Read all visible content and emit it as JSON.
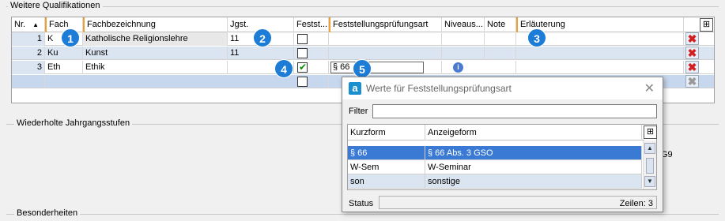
{
  "groups": {
    "weitere": "Weitere Qualifikationen",
    "wiederholte": "Wiederholte Jahrgangsstufen",
    "besonderheiten": "Besonderheiten"
  },
  "grid": {
    "columns": [
      "Nr.",
      "Fach",
      "Fachbezeichnung",
      "Jgst.",
      "Festst...",
      "Feststellungsprüfungsart",
      "Niveaus...",
      "Note",
      "Erläuterung"
    ],
    "sort_indicator": "▲",
    "rows": [
      {
        "nr": "1",
        "fach": "K",
        "bezeichnung": "Katholische Religionslehre",
        "jgst": "11",
        "festst": false,
        "art": ""
      },
      {
        "nr": "2",
        "fach": "Ku",
        "bezeichnung": "Kunst",
        "jgst": "11",
        "festst": false,
        "art": ""
      },
      {
        "nr": "3",
        "fach": "Eth",
        "bezeichnung": "Ethik",
        "jgst": "",
        "festst": true,
        "art": "§ 66"
      }
    ]
  },
  "callouts": [
    "1",
    "2",
    "3",
    "4",
    "5"
  ],
  "side_text": "G9",
  "popup": {
    "title": "Werte für Feststellungsprüfungsart",
    "logo": "a",
    "close": "✕",
    "filter_label": "Filter",
    "filter_value": "",
    "columns": [
      "Kurzform",
      "Anzeigeform"
    ],
    "rows": [
      {
        "kurz": "§ 66",
        "anzeige": "§ 66 Abs. 3 GSO"
      },
      {
        "kurz": "W-Sem",
        "anzeige": "W-Seminar"
      },
      {
        "kurz": "son",
        "anzeige": "sonstige"
      }
    ],
    "status_label": "Status",
    "count": "Zeilen: 3"
  },
  "icons": {
    "delete": "delete-icon",
    "column_chooser": "column-chooser-icon",
    "info": "info-icon"
  }
}
